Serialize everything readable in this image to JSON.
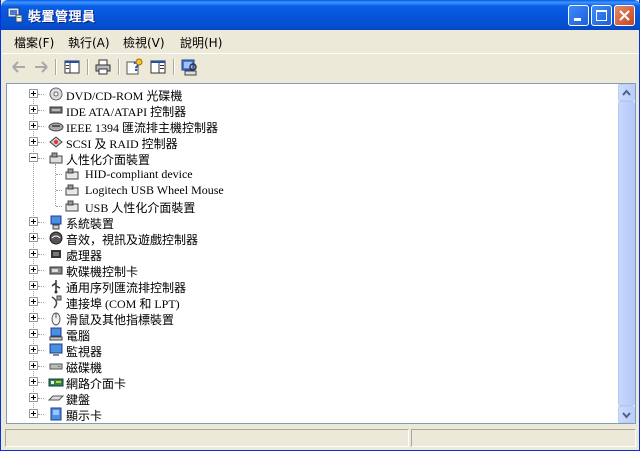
{
  "window": {
    "title": "裝置管理員"
  },
  "menu": [
    {
      "label": "檔案(F)"
    },
    {
      "label": "執行(A)"
    },
    {
      "label": "檢視(V)"
    },
    {
      "label": "說明(H)"
    }
  ],
  "toolbar": {
    "buttons": [
      "back-arrow-icon",
      "forward-arrow-icon",
      "console-tree-icon",
      "print-icon",
      "help-properties-icon",
      "show-hide-icon",
      "scan-hardware-icon"
    ]
  },
  "tree": {
    "items": [
      {
        "label": "DVD/CD-ROM 光碟機",
        "icon": "cdrom-icon",
        "expanded": false
      },
      {
        "label": "IDE ATA/ATAPI 控制器",
        "icon": "ide-controller-icon",
        "expanded": false
      },
      {
        "label": "IEEE 1394 匯流排主機控制器",
        "icon": "firewire-icon",
        "expanded": false
      },
      {
        "label": "SCSI 及 RAID 控制器",
        "icon": "scsi-icon",
        "expanded": false
      },
      {
        "label": "人性化介面裝置",
        "icon": "hid-icon",
        "expanded": true,
        "children": [
          {
            "label": "HID-compliant device",
            "icon": "hid-device-icon"
          },
          {
            "label": "Logitech USB Wheel Mouse",
            "icon": "hid-device-icon"
          },
          {
            "label": "USB 人性化介面裝置",
            "icon": "hid-device-icon"
          }
        ]
      },
      {
        "label": "系統裝置",
        "icon": "system-device-icon",
        "expanded": false
      },
      {
        "label": "音效，視訊及遊戲控制器",
        "icon": "sound-icon",
        "expanded": false
      },
      {
        "label": "處理器",
        "icon": "processor-icon",
        "expanded": false
      },
      {
        "label": "軟碟機控制卡",
        "icon": "floppy-controller-icon",
        "expanded": false
      },
      {
        "label": "通用序列匯流排控制器",
        "icon": "usb-icon",
        "expanded": false
      },
      {
        "label": "連接埠 (COM 和 LPT)",
        "icon": "port-icon",
        "expanded": false
      },
      {
        "label": "滑鼠及其他指標裝置",
        "icon": "mouse-icon",
        "expanded": false
      },
      {
        "label": "電腦",
        "icon": "computer-icon",
        "expanded": false
      },
      {
        "label": "監視器",
        "icon": "monitor-icon",
        "expanded": false
      },
      {
        "label": "磁碟機",
        "icon": "disk-drive-icon",
        "expanded": false
      },
      {
        "label": "網路介面卡",
        "icon": "network-adapter-icon",
        "expanded": false
      },
      {
        "label": "鍵盤",
        "icon": "keyboard-icon",
        "expanded": false
      },
      {
        "label": "顯示卡",
        "icon": "display-adapter-icon",
        "expanded": false
      }
    ]
  },
  "colors": {
    "titlebar": "#0655da",
    "window": "#ece9d8",
    "content": "#ffffff"
  }
}
